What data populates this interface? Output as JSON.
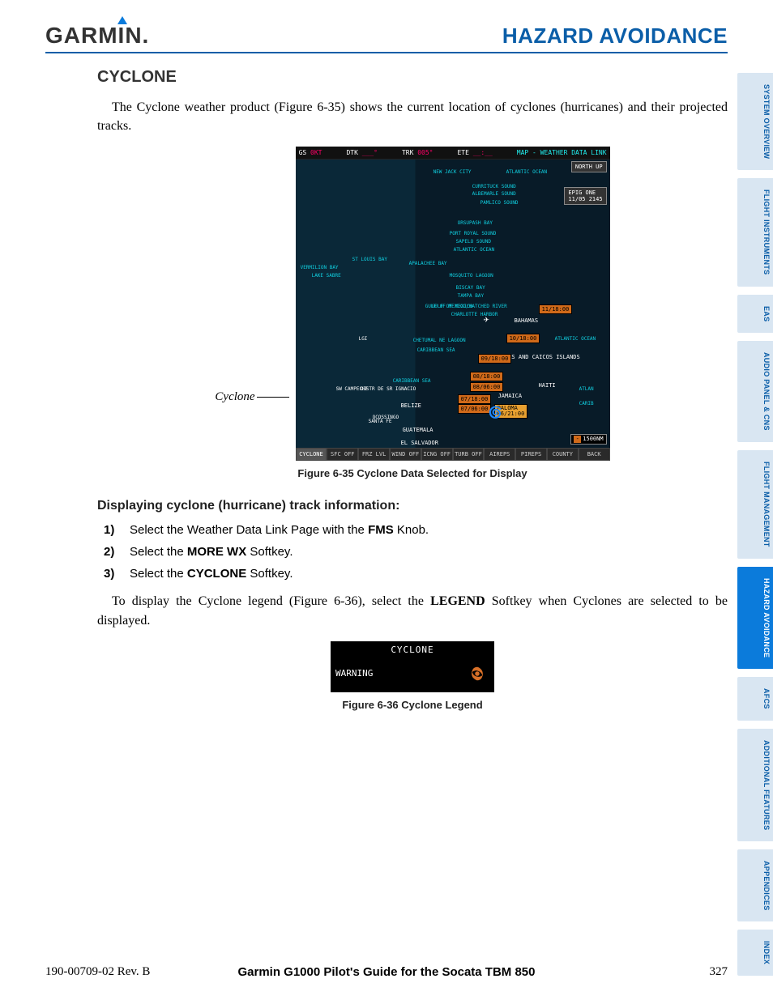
{
  "header": {
    "logo": "GARMIN.",
    "title": "HAZARD AVOIDANCE"
  },
  "section": {
    "heading": "CYCLONE",
    "intro": "The Cyclone weather product (Figure 6-35) shows the current location of cyclones (hurricanes) and their projected tracks.",
    "callout": "Cyclone",
    "figure1_caption": "Figure 6-35  Cyclone Data Selected for Display",
    "procedure_heading": "Displaying cyclone (hurricane) track information:",
    "steps": [
      {
        "n": "1)",
        "pre": "Select the Weather Data Link Page with the ",
        "bold": "FMS",
        "post": " Knob."
      },
      {
        "n": "2)",
        "pre": "Select the ",
        "bold": "MORE WX",
        "post": " Softkey."
      },
      {
        "n": "3)",
        "pre": "Select the ",
        "bold": "CYCLONE",
        "post": " Softkey."
      }
    ],
    "legend_para_pre": "To display the Cyclone legend (Figure 6-36), select the ",
    "legend_para_bold": "LEGEND",
    "legend_para_post": " Softkey when Cyclones are selected to be displayed.",
    "figure2_caption": "Figure 6-36  Cyclone Legend"
  },
  "mfd": {
    "topbar": {
      "gs_label": "GS",
      "gs_val": "0KT",
      "dtk_label": "DTK",
      "dtk_val": "___°",
      "trk_label": "TRK",
      "trk_val": "005°",
      "ete_label": "ETE",
      "ete_val": "__:__",
      "page": "MAP - WEATHER DATA LINK"
    },
    "north": "NORTH UP",
    "wxbox": {
      "line1": "EPIG ONE",
      "line2": "11/05 2145"
    },
    "coast_labels": [
      "NEW JACK CITY",
      "ATLANTIC OCEAN",
      "CURRITUCK SOUND",
      "ALBEMARLE SOUND",
      "PAMLICO SOUND",
      "ORSUPASH BAY",
      "PORT ROYAL SOUND",
      "SAPELO SOUND",
      "ATLANTIC OCEAN",
      "ST LOUIS BAY",
      "APALACHEE BAY",
      "VERMILION BAY",
      "LAKE SABRE",
      "MOSQUITO LAGOON",
      "BISCAY BAY",
      "TAMPA BAY",
      "GULF OF MEXICO",
      "CHARLOTTE HARBOR",
      "GULF OF MEXICO/HATCHED RIVER",
      "CHETUMAL NE LAGOON",
      "CARIBBEAN SEA",
      "CARIBBEAN SEA"
    ],
    "land_labels": [
      "BAHAMAS",
      "TURKS AND CAICOS ISLANDS",
      "HAITI",
      "JAMAICA",
      "BELIZE",
      "GUATEMALA",
      "EL SALVADOR",
      "DISTR DE SR IGNACIO",
      "ATLANTIC OCEAN",
      "ATLAN",
      "CARIB",
      "SW CAMPECHE",
      "OCOSSINGO",
      "SANTA FE",
      "LGI"
    ],
    "track": [
      "11/18:00",
      "10/18:00",
      "09/18:00",
      "08/18:00",
      "08/06:00",
      "07/18:00",
      "07/06:00"
    ],
    "storm": {
      "name": "PALOMA",
      "time": "06/21:00"
    },
    "scale": "1500NM",
    "softkeys": [
      "CYCLONE",
      "SFC OFF",
      "FRZ LVL",
      "WIND OFF",
      "ICNG OFF",
      "TURB OFF",
      "AIREPS",
      "PIREPS",
      "COUNTY",
      "BACK"
    ]
  },
  "legend": {
    "title": "CYCLONE",
    "label": "WARNING"
  },
  "tabs": [
    "SYSTEM OVERVIEW",
    "FLIGHT INSTRUMENTS",
    "EAS",
    "AUDIO PANEL & CNS",
    "FLIGHT MANAGEMENT",
    "HAZARD AVOIDANCE",
    "AFCS",
    "ADDITIONAL FEATURES",
    "APPENDICES",
    "INDEX"
  ],
  "footer": {
    "left": "190-00709-02 Rev. B",
    "center": "Garmin G1000 Pilot's Guide for the Socata TBM 850",
    "right": "327"
  }
}
